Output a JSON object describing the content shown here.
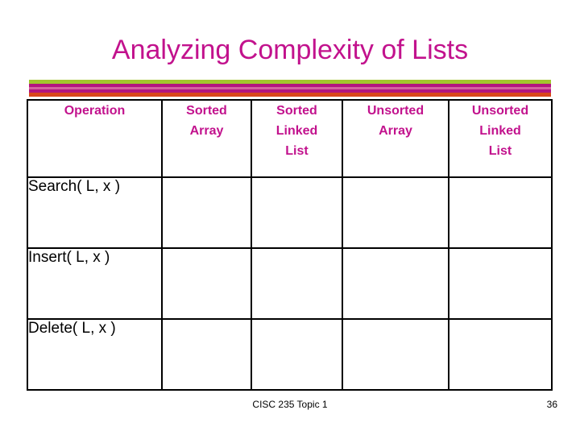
{
  "slide": {
    "title": "Analyzing Complexity of Lists",
    "accent_magenta": "#C2128D",
    "accent_green": "#A3C62D",
    "accent_pink": "#D4629F",
    "accent_orange": "#D9471C"
  },
  "rules": {
    "green_label": "green-rule",
    "magenta_label": "magenta-rule",
    "pink_label": "pink-rule",
    "orange_label": "orange-rule"
  },
  "table": {
    "headers": [
      "Operation",
      "Sorted Array",
      "Sorted Linked List",
      "Unsorted Array",
      "Unsorted Linked List"
    ],
    "header_lines": {
      "operation": "Operation",
      "sorted_array_l1": "Sorted",
      "sorted_array_l2": "Array",
      "sorted_linked_l1": "Sorted",
      "sorted_linked_l2": "Linked",
      "sorted_linked_l3": "List",
      "unsorted_array_l1": "Unsorted",
      "unsorted_array_l2": "Array",
      "unsorted_linked_l1": "Unsorted",
      "unsorted_linked_l2": "Linked",
      "unsorted_linked_l3": "List"
    },
    "rows": [
      {
        "label": "Search( L, x )",
        "sorted_array": "",
        "sorted_linked_list": "",
        "unsorted_array": "",
        "unsorted_linked_list": ""
      },
      {
        "label": "Insert( L, x )",
        "sorted_array": "",
        "sorted_linked_list": "",
        "unsorted_array": "",
        "unsorted_linked_list": ""
      },
      {
        "label": "Delete( L, x )",
        "sorted_array": "",
        "sorted_linked_list": "",
        "unsorted_array": "",
        "unsorted_linked_list": ""
      }
    ]
  },
  "footer": {
    "center": "CISC 235 Topic 1",
    "page_number": "36"
  }
}
